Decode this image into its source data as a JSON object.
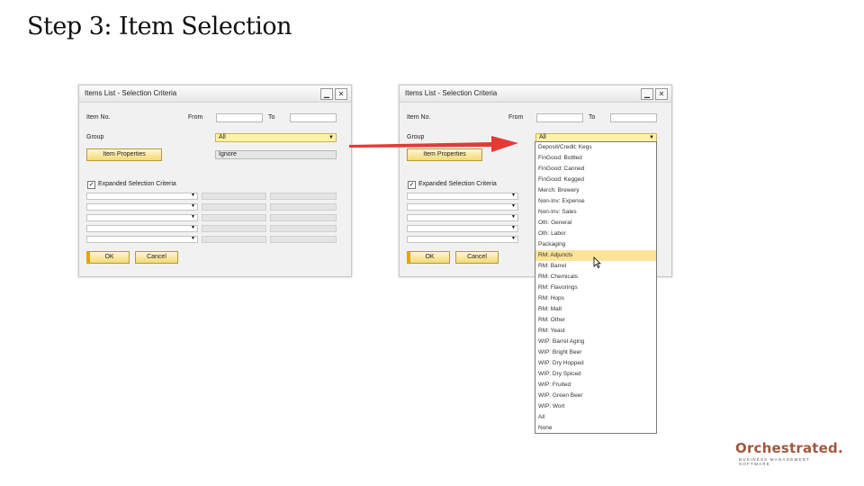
{
  "slide": {
    "title": "Step 3: Item Selection"
  },
  "window": {
    "title": "Items List - Selection Criteria",
    "minimize": "▁",
    "close": "✕",
    "item_no_label": "Item No.",
    "from_label": "From",
    "to_label": "To",
    "group_label": "Group",
    "group_value": "All",
    "item_properties_label": "Item Properties",
    "ignore_value": "Ignore",
    "expanded_label": "Expanded Selection Criteria",
    "ok_label": "OK",
    "cancel_label": "Cancel"
  },
  "dropdown_options": [
    "Deposit/Credit: Kegs",
    "FinGood: Bottled",
    "FinGood: Canned",
    "FinGood: Kegged",
    "Merch: Brewery",
    "Non-Inv: Expense",
    "Non-Inv: Sales",
    "Oth: General",
    "Oth: Labor",
    "Packaging",
    "RM: Adjuncts",
    "RM: Barrel",
    "RM: Chemicals",
    "RM: Flavorings",
    "RM: Hops",
    "RM: Malt",
    "RM: Other",
    "RM: Yeast",
    "WIP: Barrel Aging",
    "WIP: Bright Beer",
    "WIP: Dry Hopped",
    "WIP: Dry Spiced",
    "WIP: Fruited",
    "WIP: Green Beer",
    "WIP: Wort",
    "All",
    "None"
  ],
  "selected_option": "RM: Adjuncts",
  "logo": {
    "name": "Orchestrated.",
    "tagline": "BUSINESS MANAGEMENT SOFTWARE"
  },
  "colors": {
    "arrow": "#e53935",
    "highlight": "#fbe39a",
    "logo": "#a0583d"
  }
}
